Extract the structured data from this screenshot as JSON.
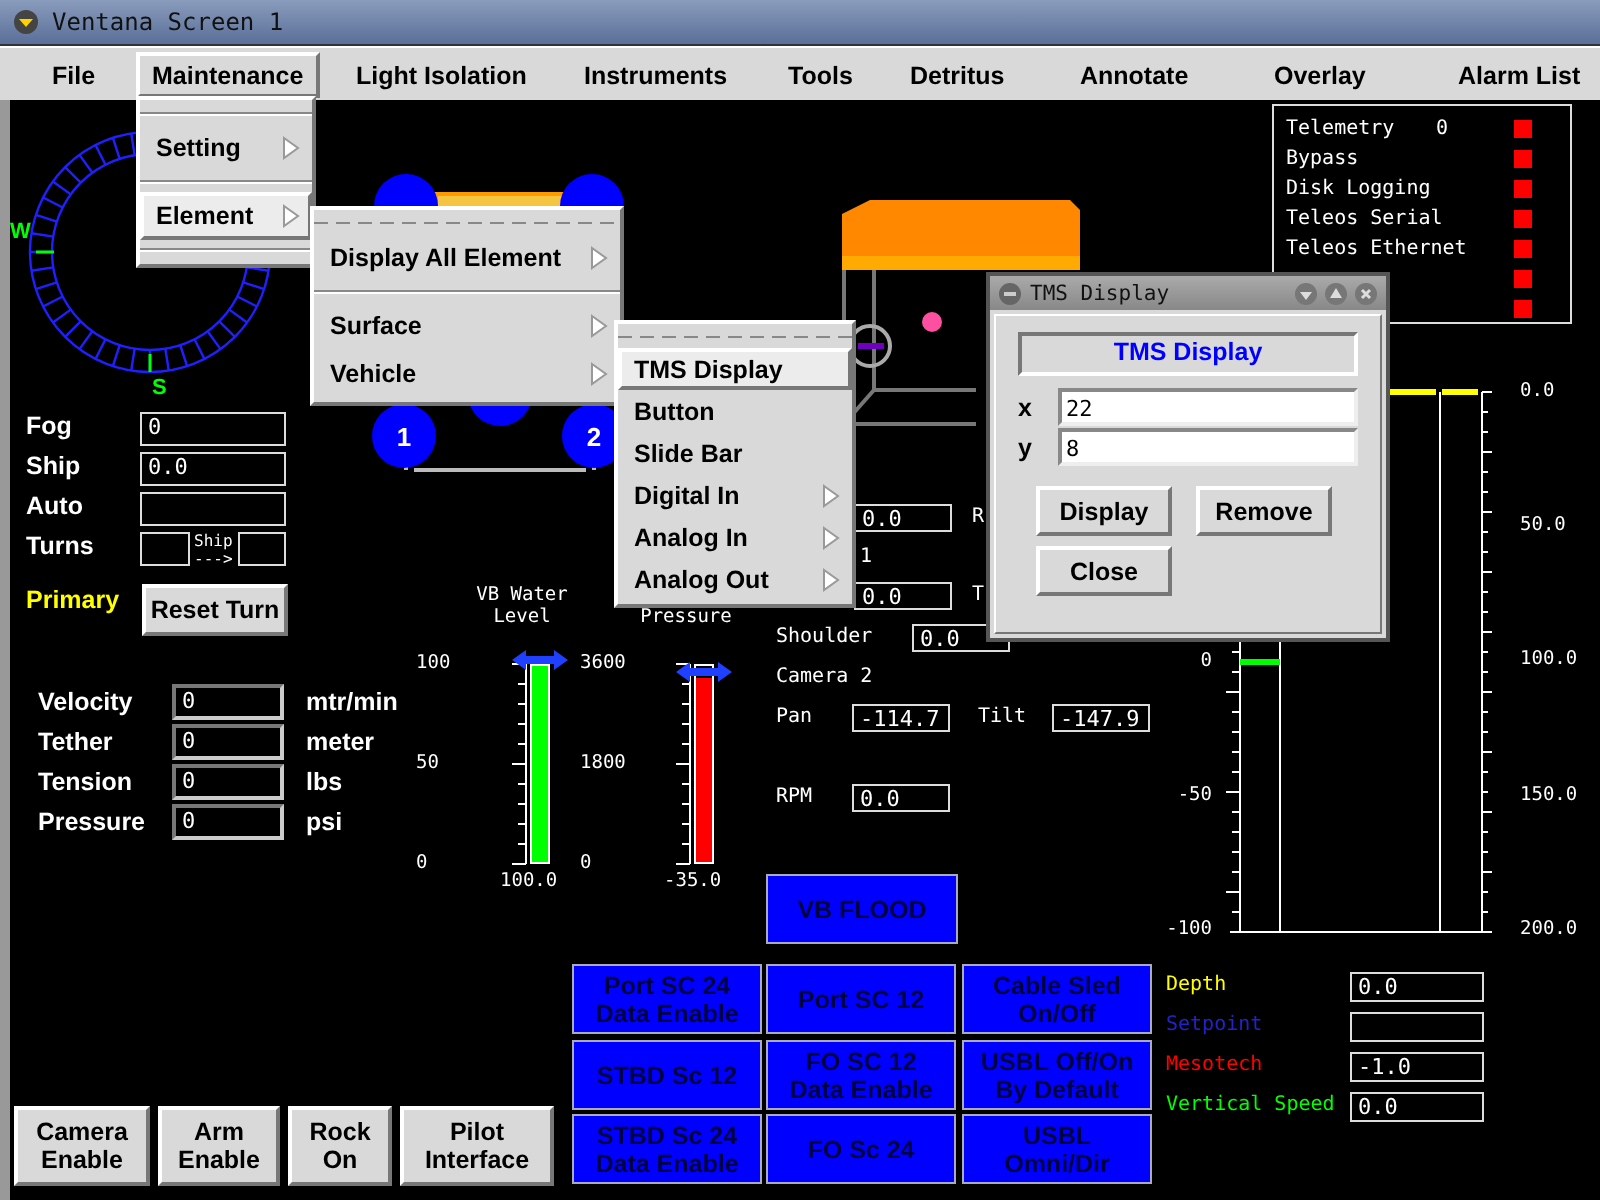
{
  "window": {
    "title": "Ventana Screen 1"
  },
  "menubar": [
    {
      "label": "File",
      "selected": false
    },
    {
      "label": "Maintenance",
      "selected": true
    },
    {
      "label": "Light Isolation",
      "selected": false
    },
    {
      "label": "Instruments",
      "selected": false
    },
    {
      "label": "Tools",
      "selected": false
    },
    {
      "label": "Detritus",
      "selected": false
    },
    {
      "label": "Annotate",
      "selected": false
    },
    {
      "label": "Overlay",
      "selected": false
    },
    {
      "label": "Alarm List",
      "selected": false
    }
  ],
  "menus": [
    {
      "items": [
        {
          "kind": "separator"
        },
        {
          "kind": "item",
          "label": "Setting",
          "submenu": true,
          "selected": false
        },
        {
          "kind": "separator"
        },
        {
          "kind": "item",
          "label": "Element",
          "submenu": true,
          "selected": true
        },
        {
          "kind": "separator"
        }
      ]
    },
    {
      "items": [
        {
          "kind": "tearoff"
        },
        {
          "kind": "item",
          "label": "Display All Element",
          "submenu": true,
          "selected": false
        },
        {
          "kind": "separator"
        },
        {
          "kind": "item",
          "label": "Surface",
          "submenu": true,
          "selected": false
        },
        {
          "kind": "item",
          "label": "Vehicle",
          "submenu": true,
          "selected": false
        }
      ]
    },
    {
      "items": [
        {
          "kind": "tearoff"
        },
        {
          "kind": "item",
          "label": "TMS Display",
          "submenu": false,
          "selected": true
        },
        {
          "kind": "item",
          "label": "Button",
          "submenu": false,
          "selected": false
        },
        {
          "kind": "item",
          "label": "Slide Bar",
          "submenu": false,
          "selected": false
        },
        {
          "kind": "item",
          "label": "Digital In",
          "submenu": true,
          "selected": false
        },
        {
          "kind": "item",
          "label": "Analog In",
          "submenu": true,
          "selected": false
        },
        {
          "kind": "item",
          "label": "Analog Out",
          "submenu": true,
          "selected": false
        }
      ]
    }
  ],
  "compass": {
    "west": "W",
    "south": "S"
  },
  "thrusters": [
    {
      "label": "1"
    },
    {
      "label": "2"
    }
  ],
  "nav_fields": [
    {
      "label": "Fog",
      "value": "0"
    },
    {
      "label": "Ship",
      "value": "0.0"
    },
    {
      "label": "Auto"
    }
  ],
  "turns": {
    "label": "Turns",
    "arrow_label": "Ship",
    "arrow": "--->"
  },
  "primary": "Primary",
  "reset_button": "Reset Turn",
  "readouts": [
    {
      "label": "Velocity",
      "value": "0",
      "unit": "mtr/min"
    },
    {
      "label": "Tether",
      "value": "0",
      "unit": "meter"
    },
    {
      "label": "Tension",
      "value": "0",
      "unit": "lbs"
    },
    {
      "label": "Pressure",
      "value": "0",
      "unit": "psi"
    }
  ],
  "gauges": [
    {
      "title": "VB Water Level",
      "ticks": [
        "100",
        "50",
        "0"
      ],
      "level": 1,
      "reading": "100.0",
      "color": "#00ff00"
    },
    {
      "title": "Pressure",
      "ticks": [
        "3600",
        "1800",
        "0"
      ],
      "level": 0.94,
      "reading": "-35.0",
      "color": "#ff0000"
    }
  ],
  "joints": [
    {
      "value": "0.0",
      "side_label": "R"
    },
    {
      "value": "0.0",
      "side_label": "T"
    }
  ],
  "camera_1_fragment": "1",
  "shoulder": {
    "label": "Shoulder",
    "value": "0.0"
  },
  "camera_2": {
    "title": "Camera 2",
    "pan_label": "Pan",
    "pan": "-114.7",
    "tilt_label": "Tilt",
    "tilt": "-147.9"
  },
  "rpm": {
    "label": "RPM",
    "value": "0.0"
  },
  "status_panel": [
    {
      "label": "Telemetry",
      "value": "0",
      "color": "#ff0000"
    },
    {
      "label": "Bypass",
      "color": "#ff0000"
    },
    {
      "label": "Disk Logging",
      "color": "#ff0000"
    },
    {
      "label": "Teleos Serial",
      "color": "#ff0000"
    },
    {
      "label": "Teleos Ethernet",
      "color": "#ff0000"
    },
    {
      "color": "#ff0000"
    },
    {
      "color": "#ff0000"
    }
  ],
  "dialog": {
    "title": "TMS Display",
    "heading": "TMS Display",
    "fields": [
      {
        "label": "x",
        "value": "22"
      },
      {
        "label": "y",
        "value": "8"
      }
    ],
    "buttons": [
      "Display",
      "Remove",
      "Close"
    ]
  },
  "depth_scale": {
    "left_ticks": [
      "0",
      "-50",
      "-100"
    ],
    "right_ticks": [
      "0.0",
      "50.0",
      "100.0",
      "150.0",
      "200.0"
    ]
  },
  "flood_button": "VB FLOOD",
  "grid_buttons": [
    "Port SC 24\nData Enable",
    "Port SC 12",
    "Cable Sled\nOn/Off",
    "STBD Sc 12",
    "FO SC 12\nData Enable",
    "USBL Off/On\nBy Default",
    "STBD Sc 24\nData Enable",
    "FO Sc 24",
    "USBL\nOmni/Dir"
  ],
  "depth_fields": [
    {
      "label": "Depth",
      "value": "0.0",
      "color": "#ffff00"
    },
    {
      "label": "Setpoint",
      "color": "#2222cc"
    },
    {
      "label": "Mesotech",
      "value": "-1.0",
      "color": "#ff0000"
    },
    {
      "label": "Vertical Speed",
      "value": "0.0",
      "color": "#00ff00"
    }
  ],
  "bottom_buttons": [
    "Camera\nEnable",
    "Arm\nEnable",
    "Rock\nOn",
    "Pilot\nInterface"
  ]
}
